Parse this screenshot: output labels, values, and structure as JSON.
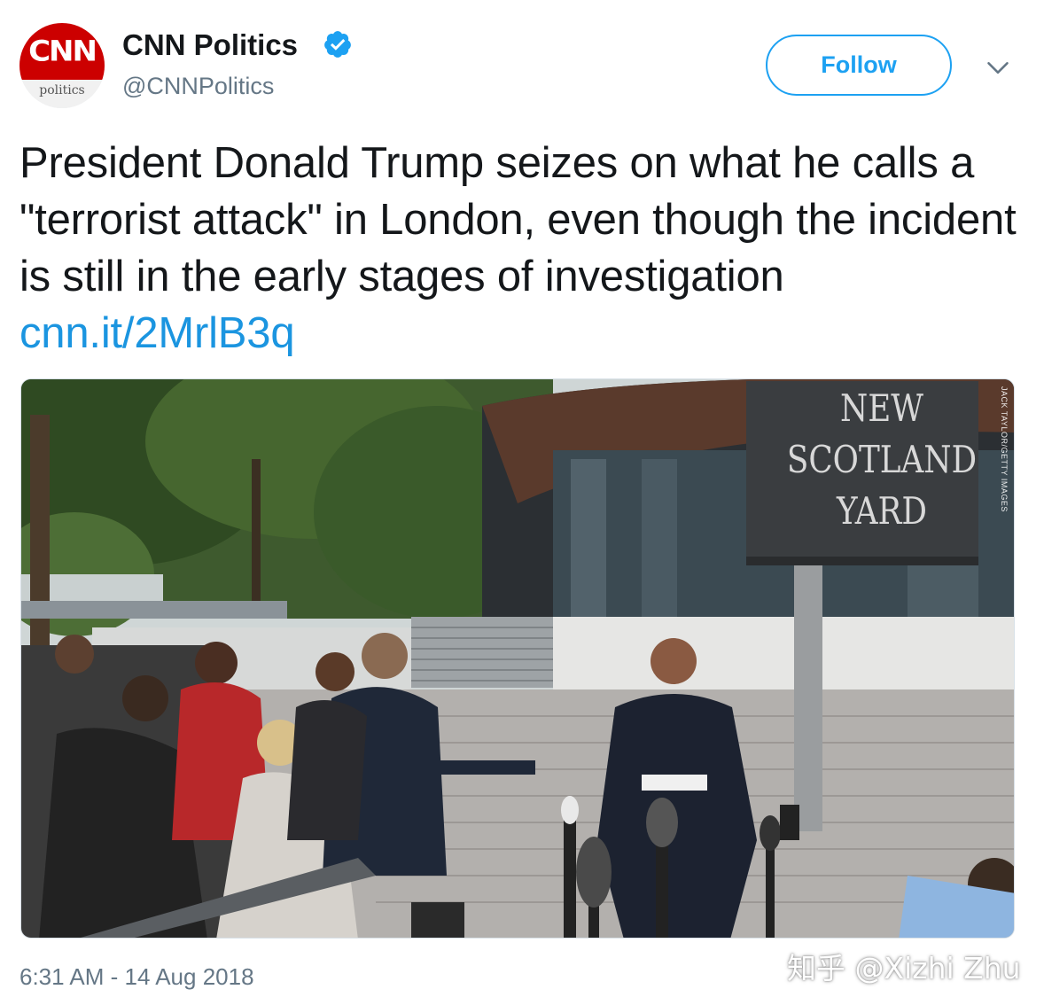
{
  "account": {
    "avatar_logo": "CNN",
    "avatar_sub": "politics",
    "display_name": "CNN Politics",
    "handle": "@CNNPolitics",
    "verified": true,
    "verified_icon": "verified-badge-icon",
    "follow_label": "Follow",
    "menu_icon": "chevron-down-icon"
  },
  "tweet": {
    "text": "President Donald Trump seizes on what he calls a \"terrorist attack\" in London, even though the incident is still in the early stages of investigation ",
    "link": "cnn.it/2MrlB3q"
  },
  "media": {
    "sign_lines": [
      "NEW",
      "SCOTLAND",
      "YARD"
    ],
    "photo_credit": "JACK TAYLOR/GETTY IMAGES"
  },
  "timestamp": "6:31 AM - 14 Aug 2018",
  "watermark": "知乎 @Xizhi Zhu",
  "colors": {
    "accent": "#1da1f2",
    "link": "#1b95e0",
    "secondary_text": "#657786",
    "cnn_red": "#cc0000"
  }
}
